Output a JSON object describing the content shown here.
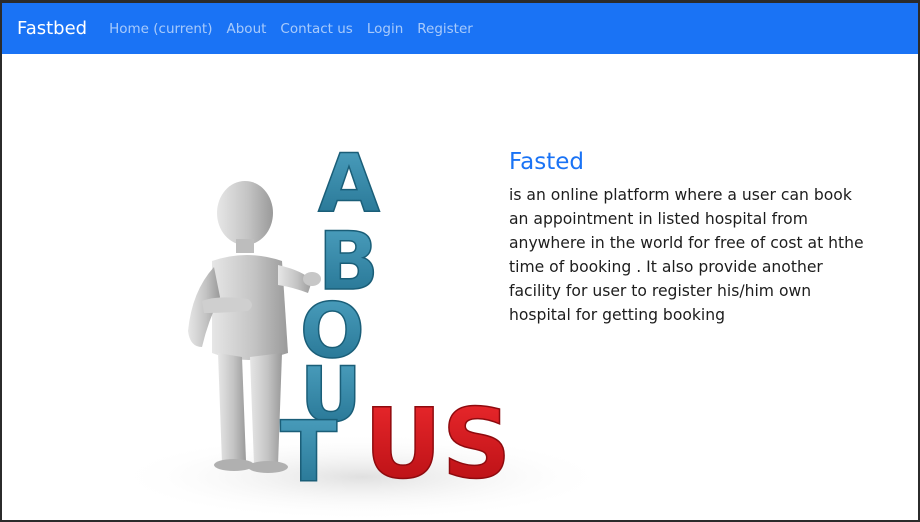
{
  "navbar": {
    "brand": "Fastbed",
    "links": [
      {
        "label": "Home (current)"
      },
      {
        "label": "About"
      },
      {
        "label": "Contact us"
      },
      {
        "label": "Login"
      },
      {
        "label": "Register"
      }
    ],
    "color": "#1a73f5"
  },
  "illustration": {
    "letters_vertical": [
      "A",
      "B",
      "O",
      "U",
      "T"
    ],
    "letters_horizontal": "US",
    "colors": {
      "teal": "#2f86a6",
      "red": "#d8141b",
      "figure": "#c9c9c9"
    }
  },
  "about": {
    "heading": "Fasted",
    "description": "is an online platform where a user can book an appointment in listed hospital from anywhere in the world for free of cost at hthe time of booking . It also provide another facility for user to register his/him own hospital for getting booking"
  }
}
